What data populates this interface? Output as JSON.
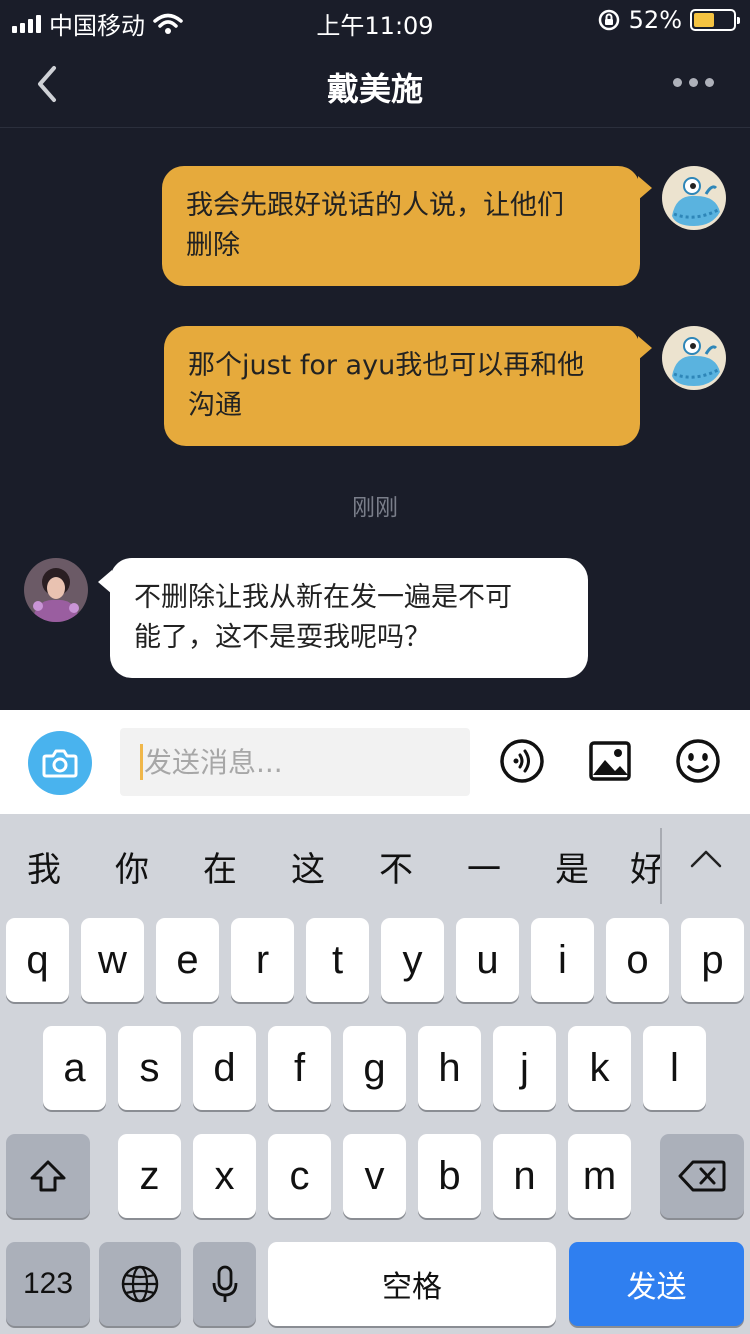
{
  "status_bar": {
    "carrier": "中国移动",
    "time": "上午11:09",
    "battery_percent": "52%",
    "battery_level": 0.52,
    "battery_color": "#f5c341"
  },
  "nav": {
    "title": "戴美施",
    "back_icon": "chevron-left-icon",
    "more_icon": "more-dots-icon"
  },
  "messages": [
    {
      "direction": "outgoing",
      "line1": "我会先跟好说话的人说，让他们",
      "line2": "删除"
    },
    {
      "direction": "outgoing",
      "line1": "那个just for ayu我也可以再和他",
      "line2": "沟通"
    },
    {
      "direction": "incoming",
      "line1": "不删除让我从新在发一遍是不可",
      "line2": "能了，这不是耍我呢吗？"
    }
  ],
  "time_label": "刚刚",
  "input_bar": {
    "placeholder": "发送消息...",
    "camera_icon": "camera-icon",
    "voice_icon": "voice-icon",
    "image_icon": "image-icon",
    "emoji_icon": "emoji-icon"
  },
  "keyboard": {
    "candidates": [
      "我",
      "你",
      "在",
      "这",
      "不",
      "一",
      "是",
      "好"
    ],
    "row1": [
      "q",
      "w",
      "e",
      "r",
      "t",
      "y",
      "u",
      "i",
      "o",
      "p"
    ],
    "row2": [
      "a",
      "s",
      "d",
      "f",
      "g",
      "h",
      "j",
      "k",
      "l"
    ],
    "row3": [
      "z",
      "x",
      "c",
      "v",
      "b",
      "n",
      "m"
    ],
    "numbers_label": "123",
    "space_label": "空格",
    "send_label": "发送",
    "shift_icon": "shift-icon",
    "backspace_icon": "backspace-icon",
    "globe_icon": "globe-icon",
    "mic_icon": "microphone-icon",
    "expand_icon": "chevron-up-icon"
  },
  "colors": {
    "outgoing_bubble": "#e6aa3c",
    "incoming_bubble": "#ffffff",
    "chat_background": "#1a1d29",
    "send_key": "#2f7ff0",
    "camera_button": "#49b3ee"
  }
}
